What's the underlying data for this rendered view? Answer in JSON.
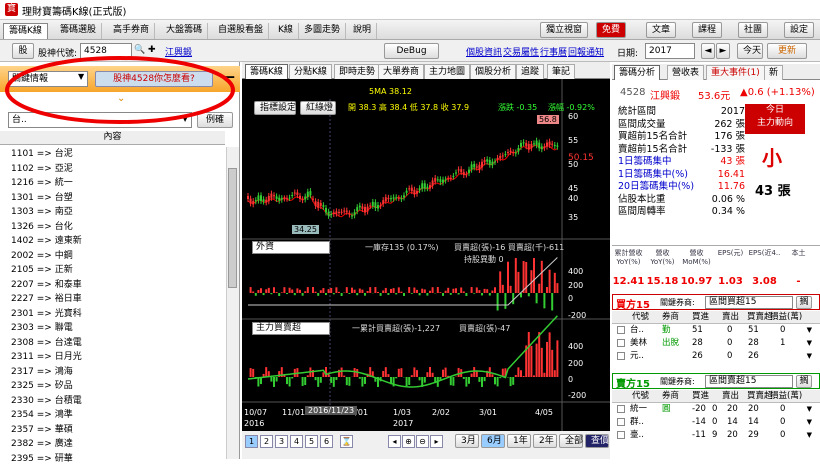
{
  "window": {
    "title": "理財寶籌碼K線(正式版)"
  },
  "top_tabs": [
    "籌碼K線",
    "籌碼選股",
    "高手券商",
    "大盤籌碼",
    "自選股看盤",
    "K線",
    "多圖走勢",
    "說明"
  ],
  "top_buttons": [
    "獨立視窗",
    "免費",
    "文章",
    "課程",
    "社團",
    "設定"
  ],
  "row2": {
    "stock_label": "股神代號:",
    "stock_value": "4528",
    "go_icon": "▼",
    "link1": "江興鍛",
    "debug": "DeBug",
    "links": [
      "個股資訊",
      "交易屬性",
      "行事曆",
      "回報通知"
    ],
    "date_label": "日期:",
    "date_value": "2017",
    "prev": "◄",
    "next": "►",
    "today": "今天",
    "refresh": "更新"
  },
  "left": {
    "dropdown": "關鍵情報",
    "ask_button": "股神4528你怎麼看?",
    "minus": "—",
    "chevron": "⌄",
    "filter_value": "台..",
    "second_btn": "例確",
    "header": "內容",
    "items": [
      "1101 => 台泥",
      "1102 => 亞泥",
      "1216 => 統一",
      "1301 => 台塑",
      "1303 => 南亞",
      "1326 => 台化",
      "1402 => 遠東新",
      "2002 => 中鋼",
      "2105 => 正新",
      "2207 => 和泰車",
      "2227 => 裕日車",
      "2301 => 光寶科",
      "2303 => 聯電",
      "2308 => 台達電",
      "2311 => 日月光",
      "2317 => 鴻海",
      "2325 => 矽品",
      "2330 => 台積電",
      "2354 => 鴻準",
      "2357 => 華碩",
      "2382 => 廣達",
      "2395 => 研華"
    ]
  },
  "chart_tabs": [
    "籌碼K線",
    "分點K線",
    "即時走勢",
    "大單券商",
    "主力地圖",
    "個股分析",
    "追蹤",
    "筆記"
  ],
  "chart": {
    "ma_label": "5MA 38.12",
    "btn1": "指標設定",
    "btn2": "紅綠燈",
    "ohlc": "開 38.3  高 38.4  低 37.8  收 37.9",
    "change": "漲跌 -0.35",
    "pct": "漲幅 -0.92%",
    "price_label": "50.15",
    "min_label": "34.25",
    "max_label": "56.8",
    "y_ticks": [
      "60",
      "55",
      "50",
      "45",
      "40",
      "35"
    ],
    "foreign": "外資",
    "foreign_info": "一庫存135 (0.17%)",
    "foreign_info2": "買賣超(張)-16 買賣超(千)-611",
    "foreign_info3": "持股異動 0",
    "foreign_ticks": [
      "400",
      "200",
      "0",
      "-200"
    ],
    "main": "主力買賣超",
    "main_info": "一累計買賣超(張)-1,227",
    "main_info2": "買賣超(張)-47",
    "main_ticks": [
      "400",
      "200",
      "0",
      "-200"
    ],
    "x_labels": [
      "10/07",
      "2016",
      "11/01",
      "12/01",
      "1/03",
      "2017",
      "2/02",
      "3/01",
      "4/05"
    ],
    "hover_date": "2016/11/23"
  },
  "pager": {
    "pages": [
      "1",
      "2",
      "3",
      "4",
      "5",
      "6"
    ],
    "ranges": [
      "3月",
      "6月",
      "1年",
      "2年",
      "全部",
      "查價"
    ]
  },
  "right": {
    "tabs": [
      "籌碼分析",
      "營收表",
      "重大事件(1)",
      "新"
    ],
    "code": "4528",
    "name": "江興鍛",
    "price": "53.6元",
    "change": "▲0.6 (+1.13%)",
    "stats": [
      {
        "k": "統計區間",
        "v": "2017"
      },
      {
        "k": "區間成交量",
        "v": "262 張"
      },
      {
        "k": "買超前15名合計",
        "v": "176 張"
      },
      {
        "k": "賣超前15名合計",
        "v": "-133 張"
      },
      {
        "k": "1日籌碼集中",
        "v": "43 張"
      },
      {
        "k": "1日籌碼集中(%)",
        "v": "16.41"
      },
      {
        "k": "20日籌碼集中(%)",
        "v": "11.76"
      },
      {
        "k": "佔股本比重",
        "v": "0.06 %"
      },
      {
        "k": "區間周轉率",
        "v": "0.34 %"
      }
    ],
    "today_title": "今日\n主力動向",
    "today_big": "小",
    "today_lots": "43 張",
    "rev_headers": [
      "累計營收YoY(%)",
      "營收YoY(%)",
      "營收MoM(%)",
      "EPS(元)",
      "EPS(近4..",
      "本土"
    ],
    "rev_values": [
      "12.41",
      "15.18",
      "10.97",
      "1.03",
      "3.08",
      "-"
    ],
    "buy_title": "買方15",
    "buy_sel": "區間買超15",
    "sell_title": "賣方15",
    "sell_sel": "區間賣超15",
    "link_label": "關鍵券商:",
    "table_headers": [
      "代號",
      "券商",
      "買進",
      "賣出",
      "買賣超",
      "損益(萬)"
    ],
    "buy_rows": [
      [
        "台..",
        "勤",
        "51",
        "",
        "0",
        "51",
        "0"
      ],
      [
        "美林",
        "出脫",
        "28",
        "",
        "0",
        "28",
        "1"
      ],
      [
        "元..",
        "",
        "26",
        "",
        "0",
        "26",
        ""
      ]
    ],
    "sell_rows": [
      [
        "統一",
        "圓",
        "-20",
        "0",
        "20",
        "20",
        "0"
      ],
      [
        "群..",
        "",
        "-14",
        "0",
        "14",
        "14",
        "0"
      ],
      [
        "臺..",
        "",
        "-11",
        "9",
        "20",
        "29",
        "0"
      ]
    ]
  }
}
